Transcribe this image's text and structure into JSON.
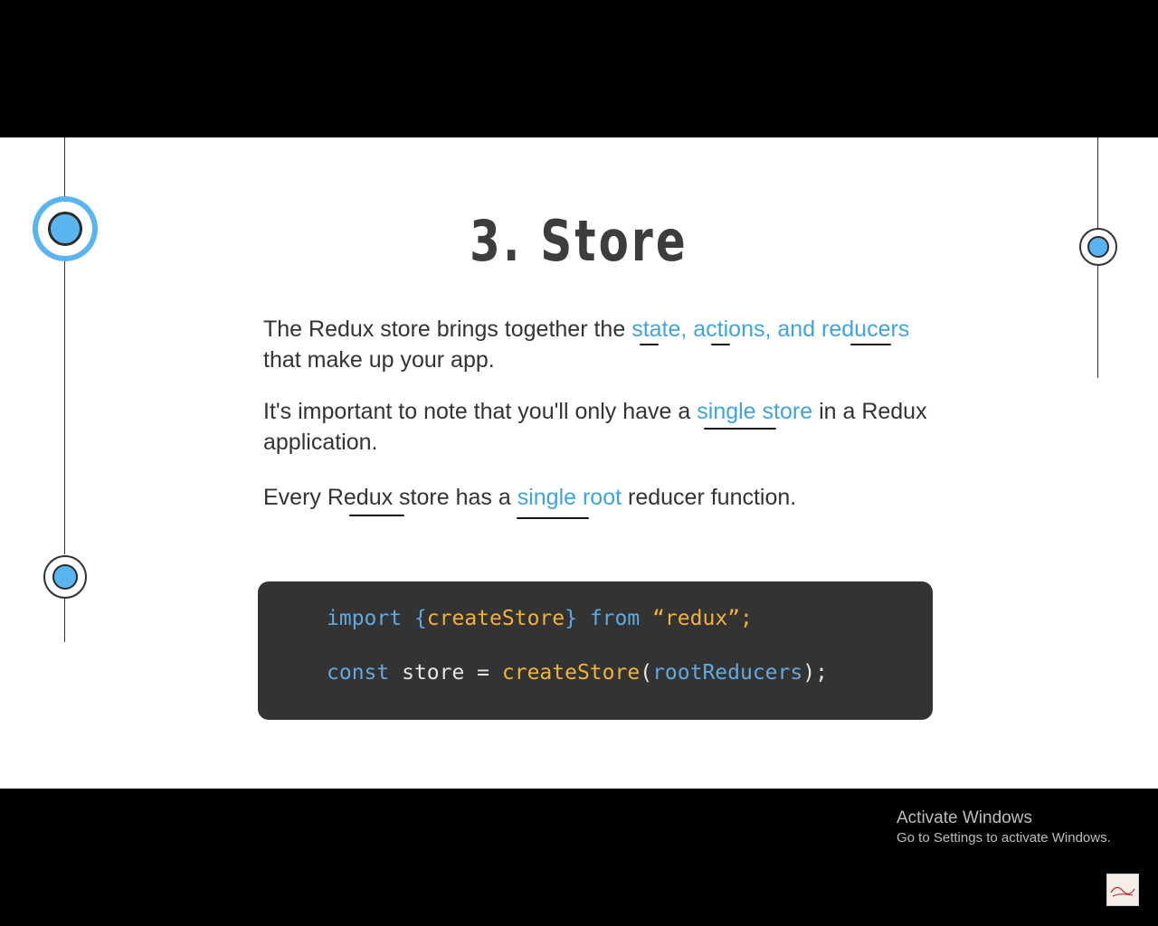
{
  "slide": {
    "title": "3. Store",
    "paragraph1": {
      "pre": "The Redux store brings together the ",
      "highlight": "state, actions, and reducers",
      "post": "that make up your app."
    },
    "paragraph2": {
      "pre": "It's important to note that you'll only have a ",
      "highlight": "single store",
      "post": " in a Redux",
      "post2": "application."
    },
    "paragraph3": {
      "pre": "Every Redux store has a ",
      "highlight": "single root",
      "post": " reducer function."
    },
    "code": {
      "line1": {
        "kw": "import",
        "brace_open": " {",
        "fn": "createStore",
        "brace_close": "}",
        "from": " from",
        "str": " “redux”;"
      },
      "line2": {
        "kw": "const",
        "mid": " store = ",
        "fn": "createStore",
        "paren_open": "(",
        "arg": "rootReducers",
        "end": ");"
      }
    }
  },
  "overlay": {
    "activate_title": "Activate Windows",
    "activate_sub": "Go to Settings to activate Windows."
  },
  "colors": {
    "accent": "#5ab4f0",
    "highlight_text": "#3fa3df",
    "code_bg": "#333333",
    "code_keyword": "#62a9df",
    "code_function": "#f0b33a"
  },
  "icons": [
    "timeline-node-icon",
    "watermark-logo-icon"
  ]
}
